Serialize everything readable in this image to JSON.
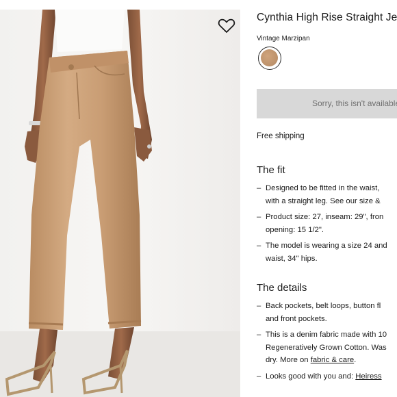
{
  "product": {
    "title": "Cynthia High Rise Straight Jeans",
    "color_name": "Vintage Marzipan",
    "swatch_color": "#c39a72",
    "soldout_label": "Sorry, this isn't available",
    "shipping": "Free shipping"
  },
  "fit": {
    "heading": "The fit",
    "bullets": [
      [
        "Designed to be fitted in the waist,",
        "with a straight leg. See our size &"
      ],
      [
        "Product size: 27, inseam: 29\", fron",
        "opening: 15 1/2\"."
      ],
      [
        "The model is wearing a size 24 and",
        "waist, 34\" hips."
      ]
    ]
  },
  "details": {
    "heading": "The details",
    "b1": [
      "Back pockets, belt loops, button fl",
      "and front pockets."
    ],
    "b2": [
      "This is a denim fabric made with 10",
      "Regeneratively Grown Cotton. Was"
    ],
    "b2_line3_pre": "dry. More on ",
    "b2_link": "fabric & care",
    "b2_line3_post": ".",
    "b3_pre": "Looks good with you and: ",
    "b3_link": "Heiress"
  },
  "icons": {
    "favorite": "heart-outline-icon"
  }
}
